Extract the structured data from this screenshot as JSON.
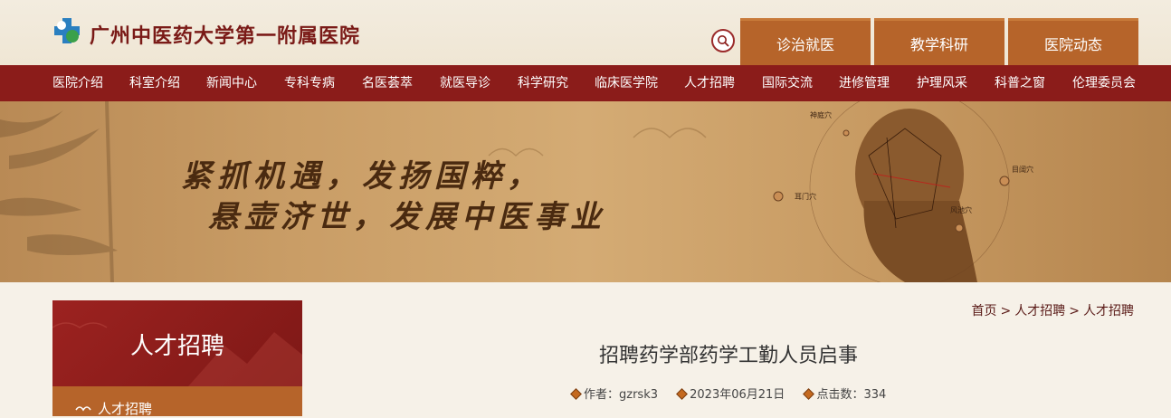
{
  "header": {
    "hospital_name": "广州中医药大学第一附属医院",
    "top_tabs": [
      "诊治就医",
      "教学科研",
      "医院动态"
    ]
  },
  "nav": {
    "items": [
      "医院介绍",
      "科室介绍",
      "新闻中心",
      "专科专病",
      "名医荟萃",
      "就医导诊",
      "科学研究",
      "临床医学院",
      "人才招聘",
      "国际交流",
      "进修管理",
      "护理风采",
      "科普之窗",
      "伦理委员会"
    ]
  },
  "banner": {
    "slogan_line1": "紧抓机遇，发扬国粹，",
    "slogan_line2": "悬壶济世，发展中医事业",
    "acupoints": [
      "神庭穴",
      "目阔穴",
      "耳门穴",
      "风池穴"
    ]
  },
  "sidebar": {
    "title": "人才招聘",
    "item": "人才招聘"
  },
  "breadcrumb": [
    "首页",
    "人才招聘",
    "人才招聘"
  ],
  "article": {
    "title": "招聘药学部药学工勤人员启事",
    "author_label": "作者：gzrsk3",
    "date": "2023年06月21日",
    "views_label": "点击数：334"
  },
  "colors": {
    "nav_red": "#8b1c1a",
    "tab_orange": "#b6642a",
    "title_red": "#7a1a17"
  }
}
